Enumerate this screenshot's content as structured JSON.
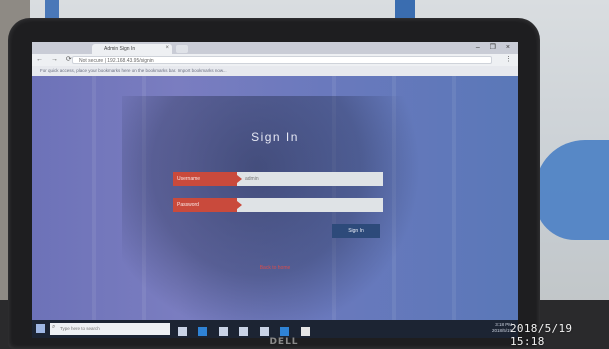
{
  "browser": {
    "tab_title": "Admin Sign In",
    "tab_close": "×",
    "window_controls": "– ❐ ×",
    "nav_controls": "← → ⟳",
    "url": "Not secure | 192.168.43.95/signin",
    "bookmarks_text": "For quick access, place your bookmarks here on the bookmarks bar. Import bookmarks now...",
    "menu_icon": "menu-dots-icon"
  },
  "page": {
    "title": "Sign In",
    "username_label": "Username",
    "username_value": "admin",
    "password_label": "Password",
    "password_value": "",
    "signin_button": "Sign In",
    "back_link": "Back to home"
  },
  "taskbar": {
    "search_placeholder": "Type here to search",
    "search_icon": "search-icon",
    "time": "3:18 PM",
    "date": "2018/5/19"
  },
  "device": {
    "brand": "DELL"
  },
  "photo": {
    "timestamp": "2018/5/19  15:18"
  },
  "colors": {
    "page_bg": "#6d72b8",
    "label_red": "#c94a3c",
    "button_navy": "#2d4a7a",
    "link_red": "#d84c4c"
  }
}
